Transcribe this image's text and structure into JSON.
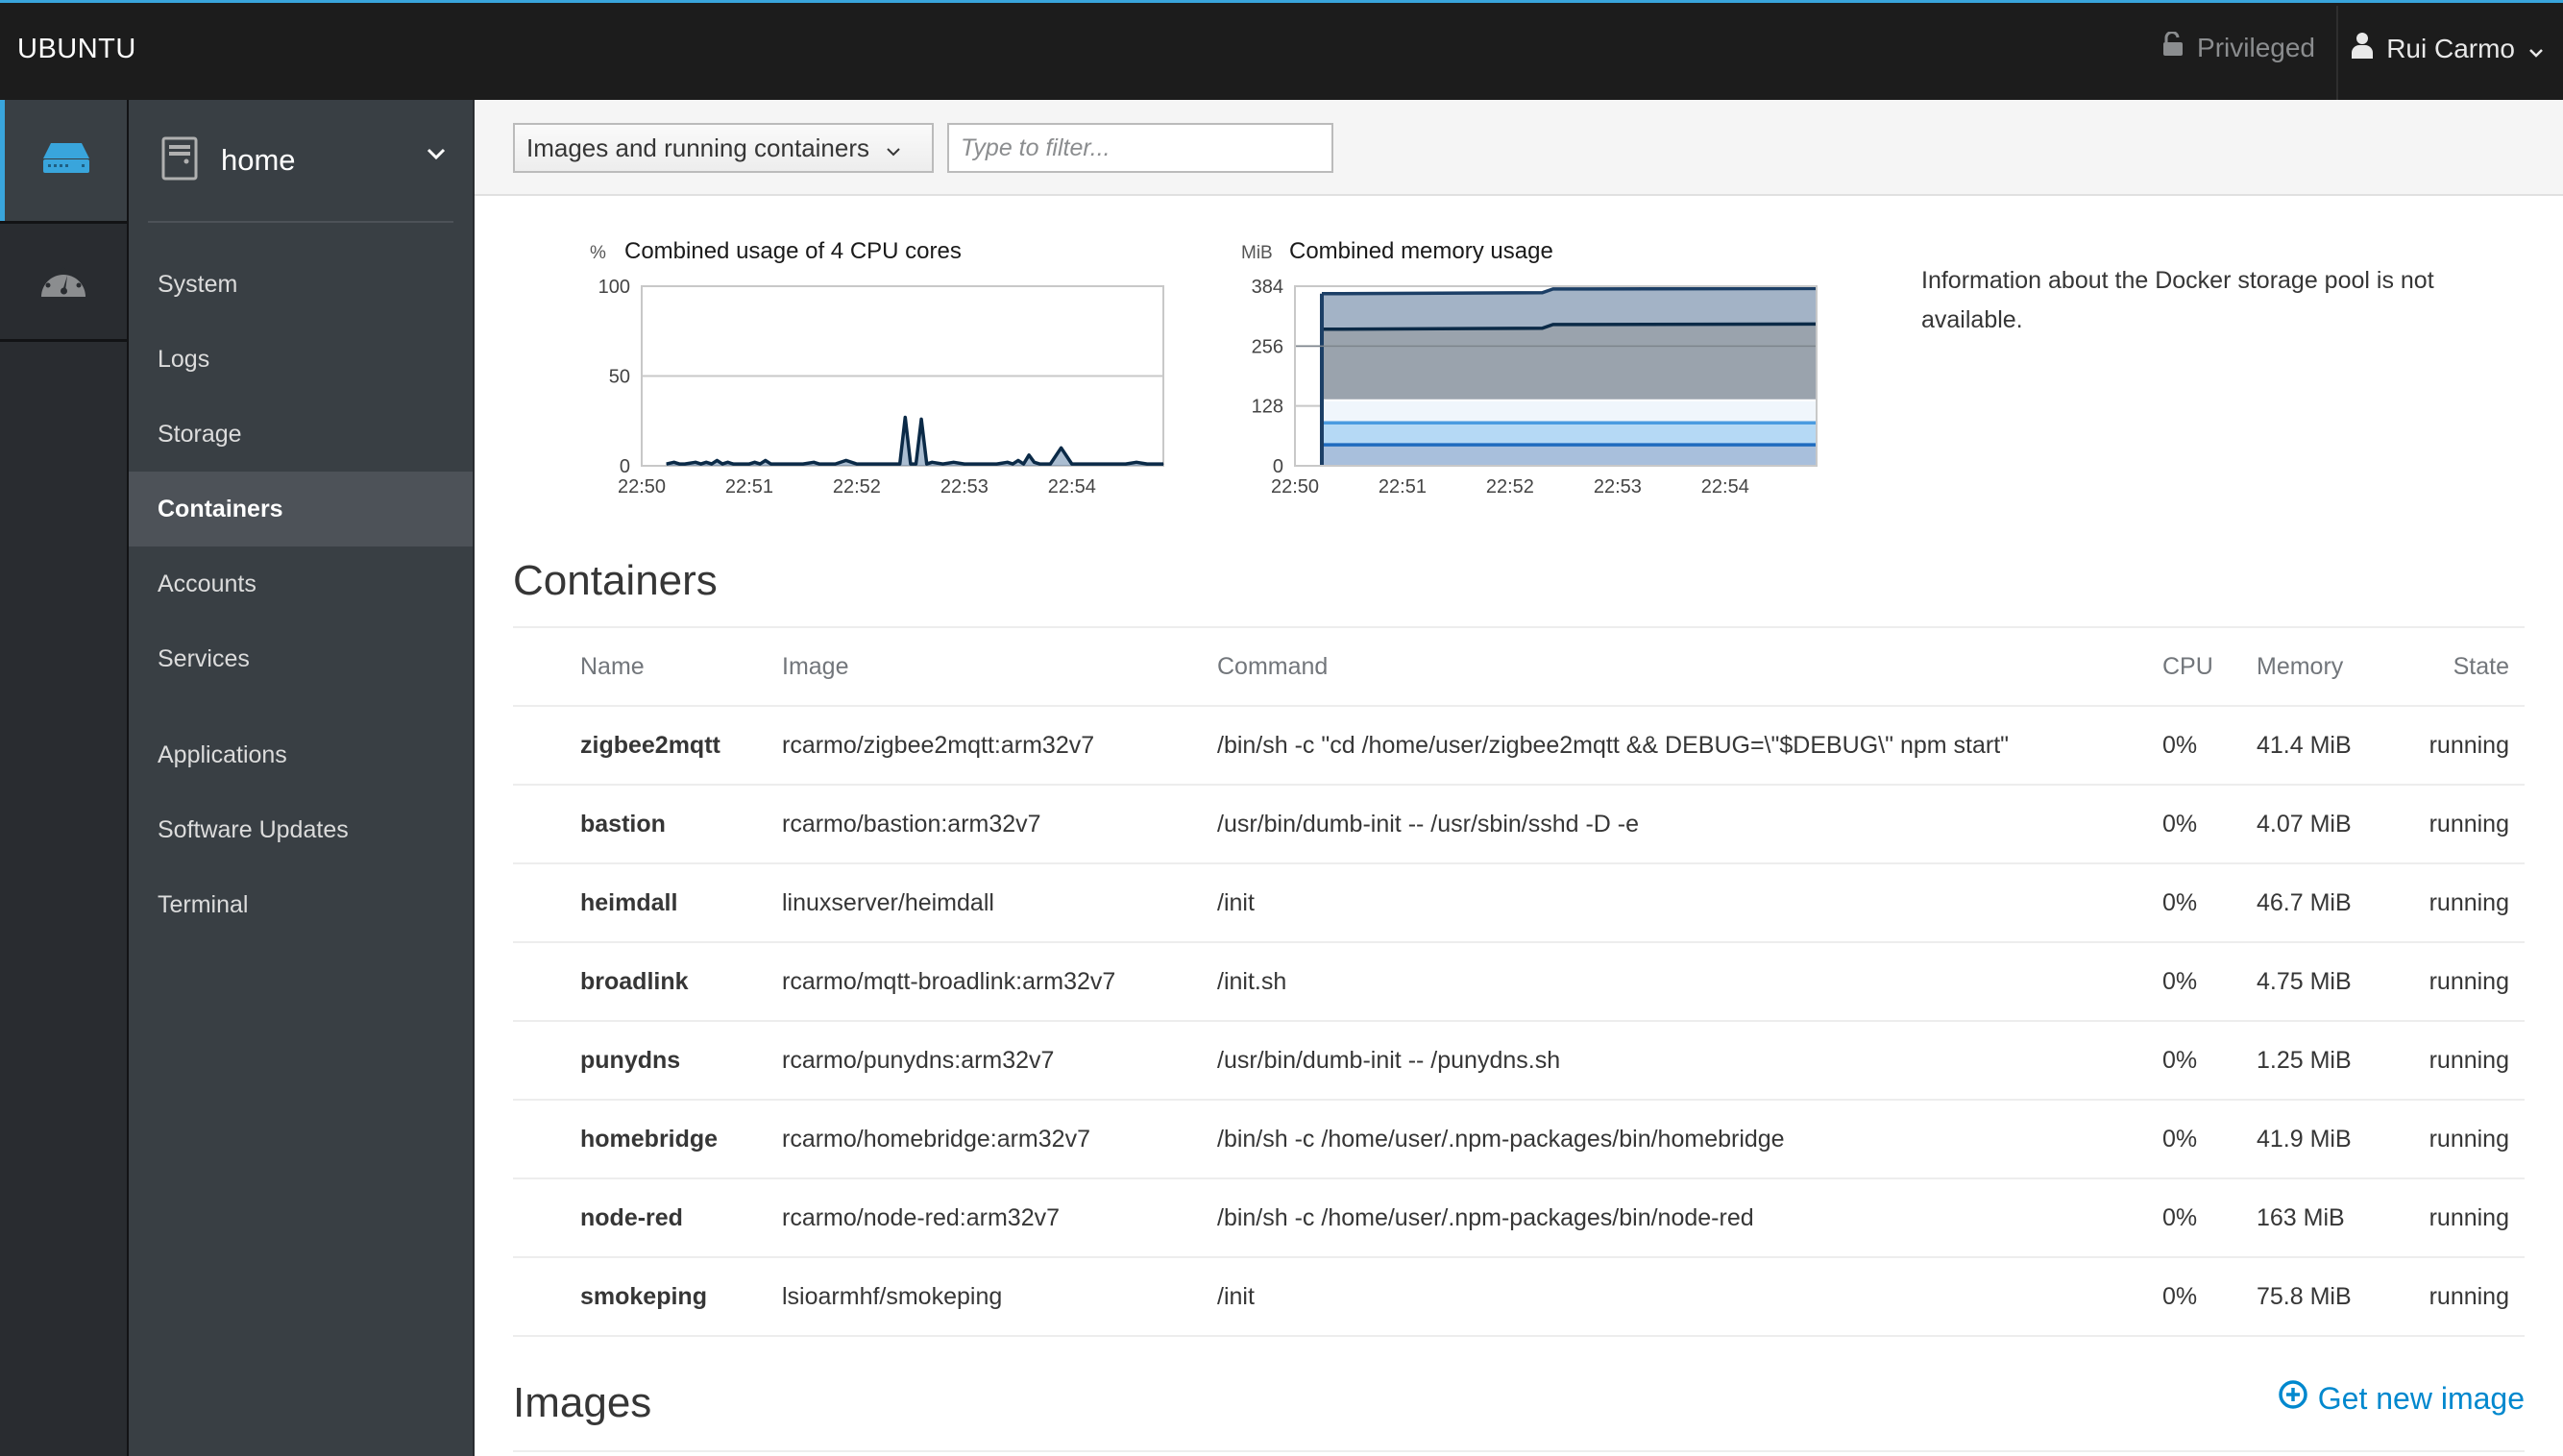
{
  "topbar": {
    "brand": "UBUNTU",
    "privileged_label": "Privileged",
    "privileged_icon": "unlock-icon",
    "user_name": "Rui Carmo",
    "user_icon": "user-icon"
  },
  "rail": {
    "items": [
      {
        "icon": "server-icon",
        "active": true
      },
      {
        "icon": "dashboard-icon",
        "active": false
      }
    ]
  },
  "nav": {
    "host": "home",
    "host_icon": "server-tower-icon",
    "items": [
      {
        "label": "System",
        "active": false
      },
      {
        "label": "Logs",
        "active": false
      },
      {
        "label": "Storage",
        "active": false
      },
      {
        "label": "Containers",
        "active": true
      },
      {
        "label": "Accounts",
        "active": false
      },
      {
        "label": "Services",
        "active": false
      },
      {
        "label": "Applications",
        "active": false
      },
      {
        "label": "Software Updates",
        "active": false
      },
      {
        "label": "Terminal",
        "active": false
      }
    ]
  },
  "toolbar": {
    "filter_select": "Images and running containers",
    "filter_placeholder": "Type to filter..."
  },
  "storage_message": "Information about the Docker storage pool is not available.",
  "containers": {
    "title": "Containers",
    "columns": [
      "Name",
      "Image",
      "Command",
      "CPU",
      "Memory",
      "State"
    ],
    "rows": [
      {
        "name": "zigbee2mqtt",
        "image": "rcarmo/zigbee2mqtt:arm32v7",
        "command": "/bin/sh -c \"cd /home/user/zigbee2mqtt && DEBUG=\\\"$DEBUG\\\" npm start\"",
        "cpu": "0%",
        "memory": "41.4 MiB",
        "state": "running"
      },
      {
        "name": "bastion",
        "image": "rcarmo/bastion:arm32v7",
        "command": "/usr/bin/dumb-init -- /usr/sbin/sshd -D -e",
        "cpu": "0%",
        "memory": "4.07 MiB",
        "state": "running"
      },
      {
        "name": "heimdall",
        "image": "linuxserver/heimdall",
        "command": "/init",
        "cpu": "0%",
        "memory": "46.7 MiB",
        "state": "running"
      },
      {
        "name": "broadlink",
        "image": "rcarmo/mqtt-broadlink:arm32v7",
        "command": "/init.sh",
        "cpu": "0%",
        "memory": "4.75 MiB",
        "state": "running"
      },
      {
        "name": "punydns",
        "image": "rcarmo/punydns:arm32v7",
        "command": "/usr/bin/dumb-init -- /punydns.sh",
        "cpu": "0%",
        "memory": "1.25 MiB",
        "state": "running"
      },
      {
        "name": "homebridge",
        "image": "rcarmo/homebridge:arm32v7",
        "command": "/bin/sh -c /home/user/.npm-packages/bin/homebridge",
        "cpu": "0%",
        "memory": "41.9 MiB",
        "state": "running"
      },
      {
        "name": "node-red",
        "image": "rcarmo/node-red:arm32v7",
        "command": "/bin/sh -c /home/user/.npm-packages/bin/node-red",
        "cpu": "0%",
        "memory": "163 MiB",
        "state": "running"
      },
      {
        "name": "smokeping",
        "image": "lsioarmhf/smokeping",
        "command": "/init",
        "cpu": "0%",
        "memory": "75.8 MiB",
        "state": "running"
      }
    ]
  },
  "images": {
    "title": "Images",
    "get_new_label": "Get new image",
    "get_new_icon": "plus-circle-icon"
  },
  "colors": {
    "accent": "#39a5dc",
    "link": "#0088ce",
    "topbar": "#1c1c1c",
    "nav": "#393f44"
  },
  "chart_data": [
    {
      "type": "line",
      "title": "Combined usage of 4 CPU cores",
      "ylabel": "%",
      "ylim": [
        0,
        100
      ],
      "yticks": [
        "0",
        "50",
        "100"
      ],
      "xticks": [
        "22:50",
        "22:51",
        "22:52",
        "22:53",
        "22:54"
      ],
      "xlim_minutes": [
        0,
        4.85
      ],
      "grid": true,
      "series": [
        {
          "name": "CPU",
          "color": "#0b2a47",
          "x_minutes": [
            0.23,
            0.3,
            0.35,
            0.4,
            0.5,
            0.55,
            0.6,
            0.65,
            0.7,
            0.75,
            0.8,
            0.85,
            0.9,
            1.0,
            1.05,
            1.1,
            1.15,
            1.2,
            1.3,
            1.5,
            1.6,
            1.65,
            1.7,
            1.8,
            1.9,
            2.0,
            2.05,
            2.1,
            2.2,
            2.4,
            2.45,
            2.5,
            2.55,
            2.6,
            2.65,
            2.7,
            2.8,
            2.9,
            3.0,
            3.3,
            3.4,
            3.45,
            3.5,
            3.55,
            3.6,
            3.65,
            3.7,
            3.75,
            3.8,
            3.9,
            4.0,
            4.1,
            4.2,
            4.3,
            4.5,
            4.6,
            4.7,
            4.85
          ],
          "values": [
            1,
            2,
            1,
            1,
            2,
            1,
            2,
            1,
            3,
            1,
            2,
            1,
            1,
            1,
            2,
            1,
            3,
            1,
            1,
            1,
            2,
            1,
            1,
            1,
            3,
            1,
            1,
            1,
            1,
            1,
            27,
            1,
            1,
            26,
            1,
            2,
            1,
            2,
            1,
            1,
            2,
            1,
            3,
            1,
            6,
            2,
            1,
            1,
            1,
            10,
            1,
            1,
            1,
            1,
            1,
            2,
            1,
            1
          ]
        }
      ]
    },
    {
      "type": "area",
      "stacked": true,
      "title": "Combined memory usage",
      "ylabel": "MiB",
      "ylim": [
        0,
        384
      ],
      "yticks": [
        "0",
        "128",
        "256",
        "384"
      ],
      "xticks": [
        "22:50",
        "22:51",
        "22:52",
        "22:53",
        "22:54"
      ],
      "xlim_minutes": [
        0,
        4.85
      ],
      "grid": true,
      "series": [
        {
          "name": "layer-1",
          "color": "#a8bfdc",
          "x_minutes": [
            0.25,
            2.3,
            2.4,
            4.85
          ],
          "values": [
            45,
            45,
            45,
            45
          ]
        },
        {
          "name": "layer-2",
          "color": "#b5d9f5",
          "x_minutes": [
            0.25,
            2.3,
            2.4,
            4.85
          ],
          "values": [
            92,
            92,
            92,
            92
          ]
        },
        {
          "name": "layer-3",
          "color": "#f0f6fc",
          "x_minutes": [
            0.25,
            2.3,
            2.4,
            4.85
          ],
          "values": [
            140,
            140,
            140,
            140
          ]
        },
        {
          "name": "layer-4",
          "color": "#9aa3ad",
          "x_minutes": [
            0.25,
            2.3,
            2.4,
            4.85
          ],
          "values": [
            292,
            294,
            302,
            303
          ]
        },
        {
          "name": "layer-5",
          "color": "#a3b3c6",
          "x_minutes": [
            0.25,
            2.3,
            2.4,
            4.85
          ],
          "values": [
            368,
            370,
            378,
            379
          ]
        }
      ]
    }
  ]
}
